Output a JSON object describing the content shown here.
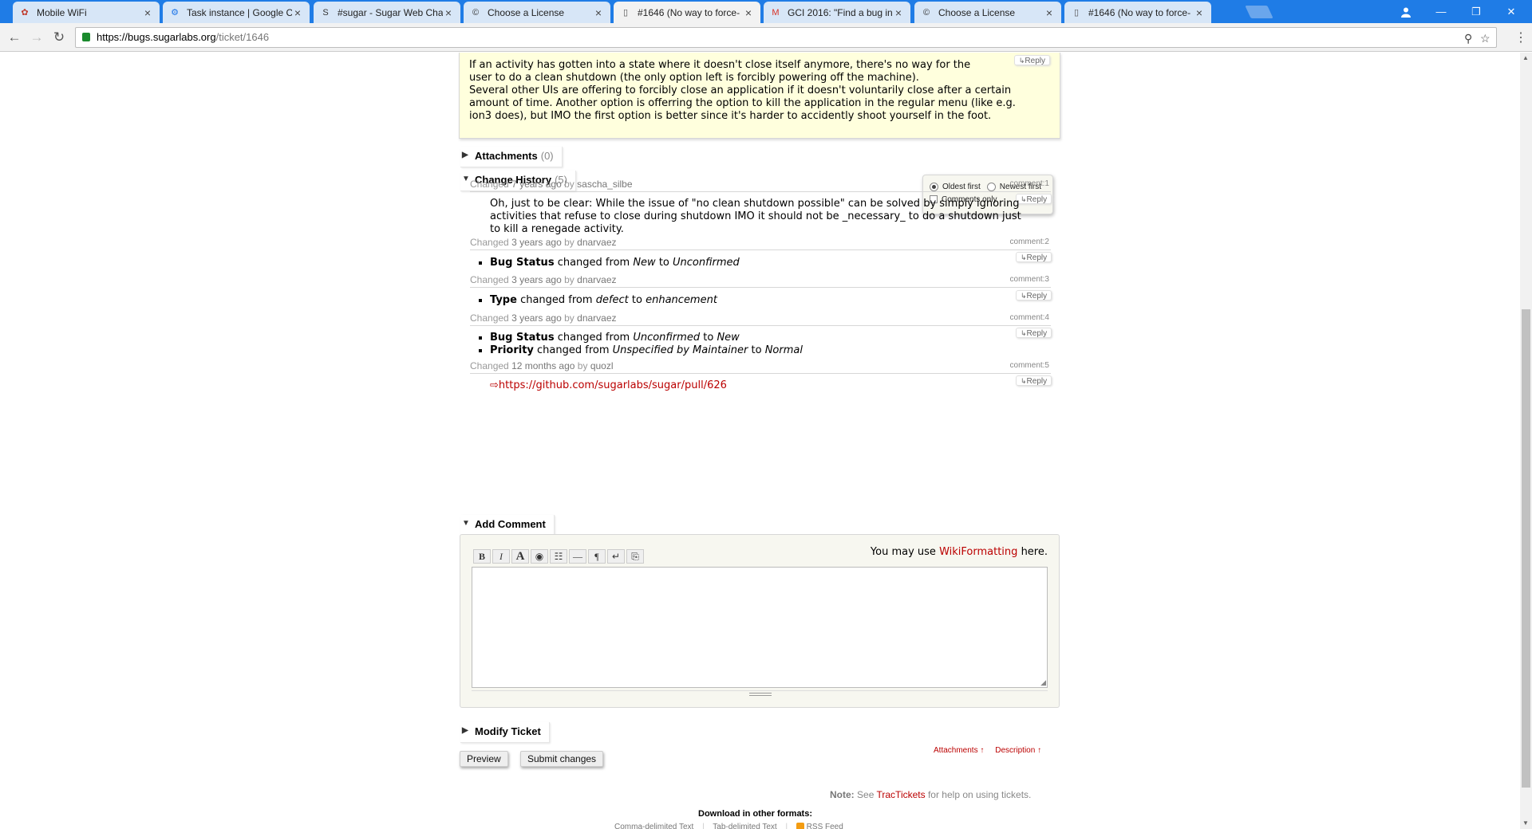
{
  "browser": {
    "tabs": [
      {
        "title": "Mobile WiFi",
        "icon": "huawei-icon",
        "color": "#c0392b"
      },
      {
        "title": "Task instance | Google Co",
        "icon": "gear-icon",
        "color": "#1a73e8"
      },
      {
        "title": "#sugar - Sugar Web Chat",
        "icon": "s-icon",
        "color": "#333"
      },
      {
        "title": "Choose a License",
        "icon": "cc-icon",
        "color": "#333"
      },
      {
        "title": "#1646 (No way to force-",
        "icon": "page-icon",
        "color": "#555",
        "active": true
      },
      {
        "title": "GCI 2016: \"Find a bug in",
        "icon": "gmail-icon",
        "color": "#d93025"
      },
      {
        "title": "Choose a License",
        "icon": "cc-icon",
        "color": "#333"
      },
      {
        "title": "#1646 (No way to force-",
        "icon": "page-icon",
        "color": "#555"
      }
    ],
    "url_host": "https://bugs.sugarlabs.org",
    "url_path": "/ticket/1646"
  },
  "description": {
    "lines": [
      "If an activity has gotten into a state where it doesn't close itself anymore, there's no way for the",
      "user to do a clean shutdown (the only option left is forcibly powering off the machine).",
      "Several other UIs are offering to forcibly close an application if it doesn't voluntarily close after a certain",
      "amount of time. Another option is offerring the option to kill the application in the regular menu (like e.g.",
      "ion3 does), but IMO the first option is better since it's harder to accidently shoot yourself in the foot."
    ],
    "reply": "Reply"
  },
  "attachments": {
    "label": "Attachments",
    "count": "(0)"
  },
  "history": {
    "label": "Change History",
    "count": "(5)",
    "prefs": {
      "oldest": "Oldest first",
      "newest": "Newest first",
      "comments_only": "Comments only"
    },
    "changes": [
      {
        "prefix": "Changed",
        "when": "7 years ago",
        "by": "by",
        "who": "sascha_silbe",
        "cnum": "comment:1",
        "text": "Oh, just to be clear: While the issue of \"no clean shutdown possible\" can be solved by simply ignoring activities that refuse to close during shutdown IMO it should not be _necessary_ to do a shutdown just to kill a renegade activity."
      },
      {
        "prefix": "Changed",
        "when": "3 years ago",
        "by": "by",
        "who": "dnarvaez",
        "cnum": "comment:2",
        "items": [
          {
            "field": "Bug Status",
            "verb": "changed from",
            "from": "New",
            "to_word": "to",
            "to": "Unconfirmed"
          }
        ]
      },
      {
        "prefix": "Changed",
        "when": "3 years ago",
        "by": "by",
        "who": "dnarvaez",
        "cnum": "comment:3",
        "items": [
          {
            "field": "Type",
            "verb": "changed from",
            "from": "defect",
            "to_word": "to",
            "to": "enhancement"
          }
        ]
      },
      {
        "prefix": "Changed",
        "when": "3 years ago",
        "by": "by",
        "who": "dnarvaez",
        "cnum": "comment:4",
        "items": [
          {
            "field": "Bug Status",
            "verb": "changed from",
            "from": "Unconfirmed",
            "to_word": "to",
            "to": "New"
          },
          {
            "field": "Priority",
            "verb": "changed from",
            "from": "Unspecified by Maintainer",
            "to_word": "to",
            "to": "Normal"
          }
        ]
      },
      {
        "prefix": "Changed",
        "when": "12 months ago",
        "by": "by",
        "who": "quozl",
        "cnum": "comment:5",
        "link": "https://github.com/sugarlabs/sugar/pull/626"
      }
    ]
  },
  "add_comment": {
    "label": "Add Comment",
    "wiki_pre": "You may use",
    "wiki_link": "WikiFormatting",
    "wiki_post": "here.",
    "toolbar": [
      "B",
      "I",
      "A",
      "◉",
      "☷",
      "—",
      "¶",
      "↵",
      "⎘"
    ]
  },
  "modify": {
    "label": "Modify Ticket"
  },
  "buttons": {
    "preview": "Preview",
    "submit": "Submit changes"
  },
  "backlinks": {
    "attachments": "Attachments ↑",
    "description": "Description ↑"
  },
  "footer": {
    "note_label": "Note:",
    "note_pre": "See",
    "note_link": "TracTickets",
    "note_post": "for help on using tickets.",
    "download": "Download in other formats:",
    "formats": [
      "Comma-delimited Text",
      "Tab-delimited Text",
      "RSS Feed"
    ]
  }
}
